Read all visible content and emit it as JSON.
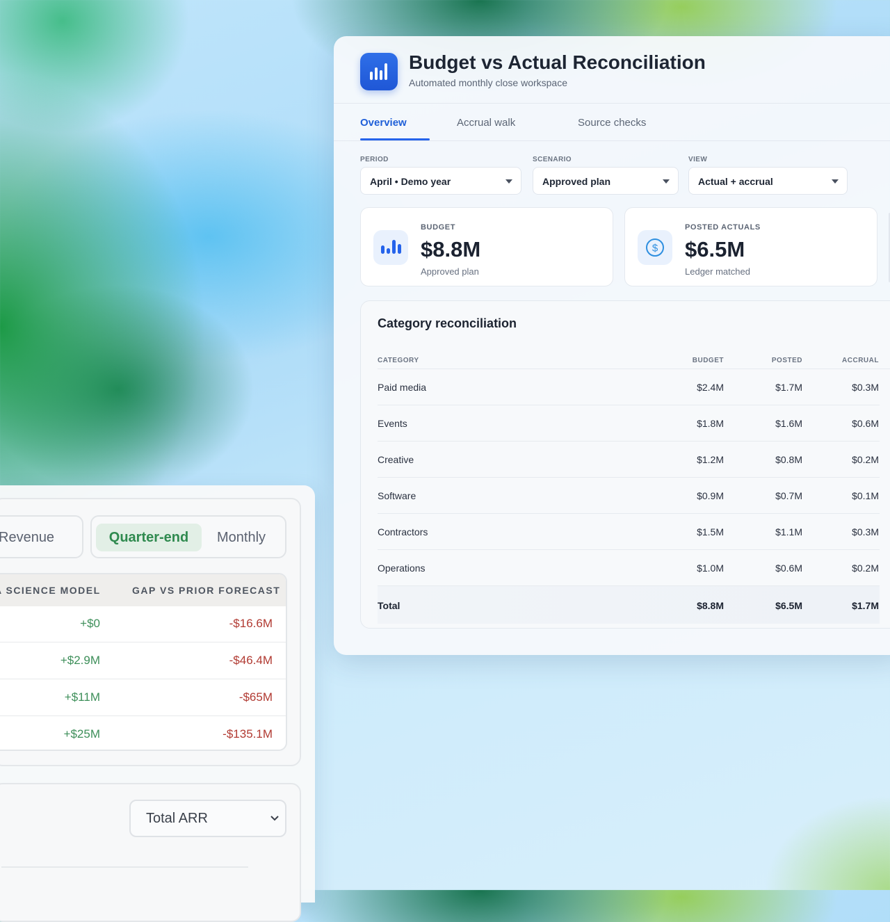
{
  "app": {
    "title": "Budget vs Actual Reconciliation",
    "subtitle": "Automated monthly close workspace",
    "logo_icon": "bar-chart-icon",
    "accent": "#2563eb"
  },
  "tabs": [
    {
      "label": "Overview",
      "active": true
    },
    {
      "label": "Accrual walk",
      "active": false
    },
    {
      "label": "Source checks",
      "active": false
    }
  ],
  "filters": {
    "period": {
      "label": "PERIOD",
      "value": "April • Demo year"
    },
    "scenario": {
      "label": "SCENARIO",
      "value": "Approved plan"
    },
    "view": {
      "label": "VIEW",
      "value": "Actual + accrual"
    }
  },
  "kpis": [
    {
      "label": "BUDGET",
      "value": "$8.8M",
      "note": "Approved plan",
      "icon": "bar-chart-icon"
    },
    {
      "label": "POSTED ACTUALS",
      "value": "$6.5M",
      "note": "Ledger matched",
      "icon": "dollar-circle-icon"
    }
  ],
  "reconciliation": {
    "title": "Category reconciliation",
    "columns": [
      "CATEGORY",
      "BUDGET",
      "POSTED",
      "ACCRUAL"
    ],
    "rows": [
      {
        "category": "Paid media",
        "budget": "$2.4M",
        "posted": "$1.7M",
        "accrual": "$0.3M"
      },
      {
        "category": "Events",
        "budget": "$1.8M",
        "posted": "$1.6M",
        "accrual": "$0.6M"
      },
      {
        "category": "Creative",
        "budget": "$1.2M",
        "posted": "$0.8M",
        "accrual": "$0.2M"
      },
      {
        "category": "Software",
        "budget": "$0.9M",
        "posted": "$0.7M",
        "accrual": "$0.1M"
      },
      {
        "category": "Contractors",
        "budget": "$1.5M",
        "posted": "$1.1M",
        "accrual": "$0.3M"
      },
      {
        "category": "Operations",
        "budget": "$1.0M",
        "posted": "$0.6M",
        "accrual": "$0.2M"
      }
    ],
    "total": {
      "category": "Total",
      "budget": "$8.8M",
      "posted": "$6.5M",
      "accrual": "$1.7M"
    }
  },
  "left_panel": {
    "segment_a": {
      "label": "Revenue"
    },
    "segment_b": [
      {
        "label": "Quarter-end",
        "active": true
      },
      {
        "label": "Monthly",
        "active": false
      }
    ],
    "table_headers": [
      "A SCIENCE MODEL",
      "GAP VS PRIOR FORECAST"
    ],
    "rows": [
      {
        "model": "+$0",
        "gap": "-$16.6M"
      },
      {
        "model": "+$2.9M",
        "gap": "-$46.4M"
      },
      {
        "model": "+$11M",
        "gap": "-$65M"
      },
      {
        "model": "+$25M",
        "gap": "-$135.1M"
      }
    ],
    "metric_select": {
      "value": "Total ARR"
    },
    "colors": {
      "positive": "#3e8f5a",
      "negative": "#b13a32",
      "active_segment": "#2f8a4f"
    }
  }
}
